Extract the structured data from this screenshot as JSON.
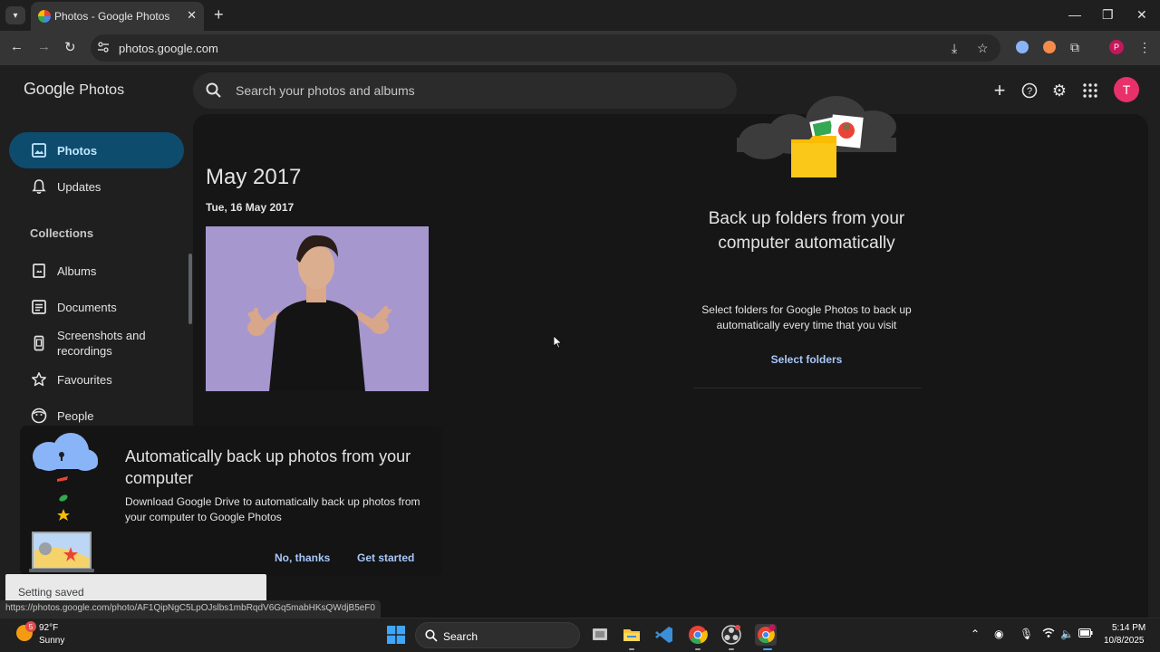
{
  "browser": {
    "tab_title": "Photos - Google Photos",
    "url": "photos.google.com",
    "status_url": "https://photos.google.com/photo/AF1QipNgC5LpOJslbs1mbRqdV6Gq5mabHKsQWdjB5eF0"
  },
  "header": {
    "logo_google": "Google",
    "logo_photos": "Photos",
    "search_placeholder": "Search your photos and albums",
    "avatar_letter": "T"
  },
  "sidebar": {
    "items": [
      {
        "label": "Photos",
        "icon": "photo-icon"
      },
      {
        "label": "Updates",
        "icon": "bell-icon"
      }
    ],
    "collections_header": "Collections",
    "collections": [
      {
        "label": "Albums",
        "icon": "album-icon"
      },
      {
        "label": "Documents",
        "icon": "document-icon"
      },
      {
        "label": "Screenshots and recordings",
        "icon": "phone-icon"
      },
      {
        "label": "Favourites",
        "icon": "star-icon"
      },
      {
        "label": "People",
        "icon": "face-icon"
      }
    ]
  },
  "main": {
    "month": "May 2017",
    "day": "Tue, 16 May 2017"
  },
  "backup_card": {
    "title": "Back up folders from your computer automatically",
    "description": "Select folders for Google Photos to back up automatically every time that you visit",
    "action": "Select folders"
  },
  "promo": {
    "title": "Automatically back up photos from your computer",
    "description": "Download Google Drive to automatically back up photos from your computer to Google Photos",
    "dismiss": "No, thanks",
    "accept": "Get started"
  },
  "toast": {
    "message": "Setting saved"
  },
  "taskbar": {
    "weather_badge": "5",
    "temperature": "92°F",
    "condition": "Sunny",
    "search_label": "Search",
    "time": "5:14 PM",
    "date": "10/8/2025"
  },
  "colors": {
    "accent": "#0e4c6e",
    "link": "#a8c7fa",
    "avatar": "#e8316b"
  }
}
